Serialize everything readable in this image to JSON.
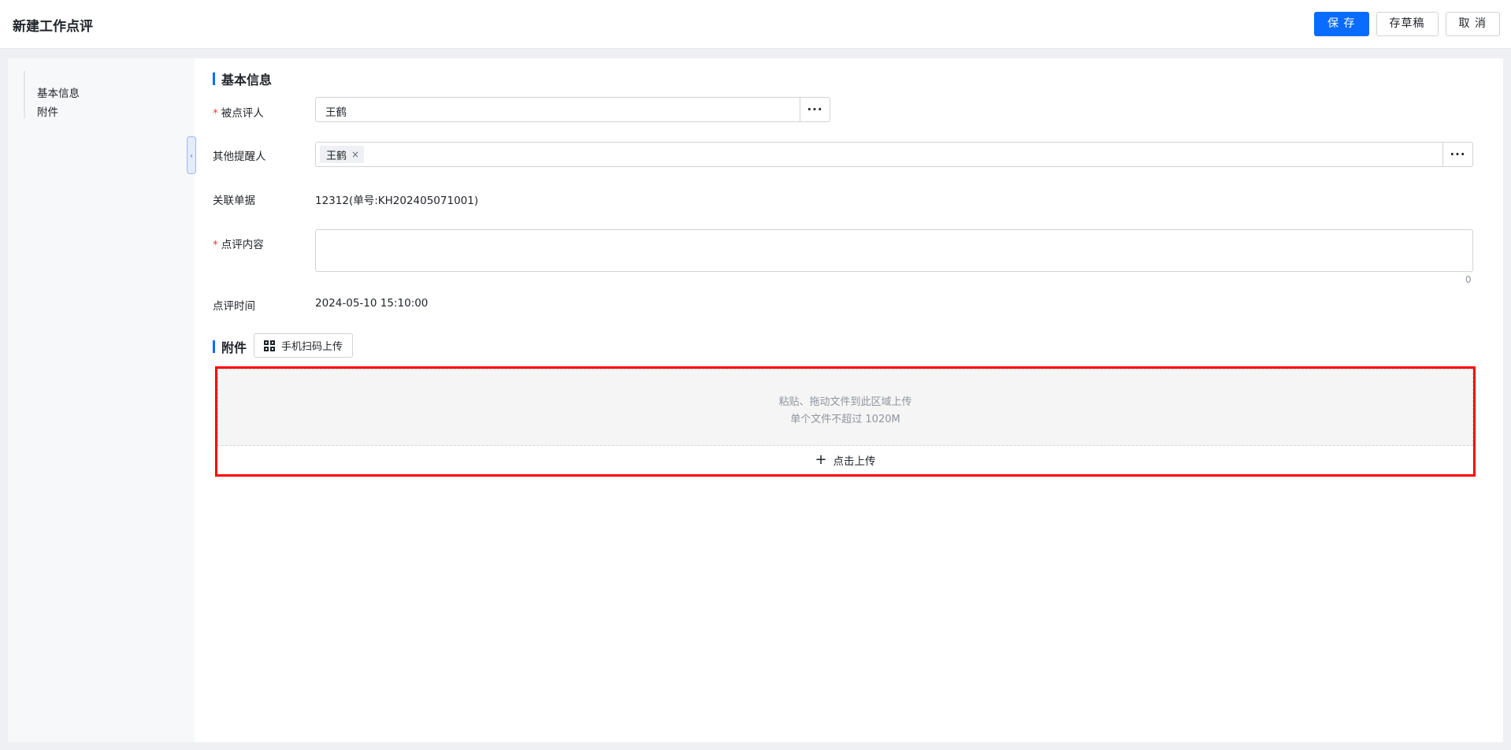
{
  "header": {
    "title": "新建工作点评",
    "save_label": "保 存",
    "draft_label": "存草稿",
    "cancel_label": "取 消"
  },
  "sidebar": {
    "items": [
      {
        "label": "基本信息"
      },
      {
        "label": "附件"
      }
    ],
    "collapse_icon": "chevron-left-icon"
  },
  "basic_info": {
    "section_title": "基本信息",
    "reviewee": {
      "label": "被点评人",
      "value": "王鹤",
      "required": true
    },
    "reminders": {
      "label": "其他提醒人",
      "tags": [
        "王鹤"
      ]
    },
    "related_doc": {
      "label": "关联单据",
      "value": "12312(单号:KH202405071001)"
    },
    "review_content": {
      "label": "点评内容",
      "value": "",
      "char_count": "0",
      "required": true
    },
    "review_time": {
      "label": "点评时间",
      "value": "2024-05-10 15:10:00"
    }
  },
  "attachments": {
    "section_title": "附件",
    "scan_upload_label": "手机扫码上传",
    "drop_hint": "粘贴、拖动文件到此区域上传",
    "size_hint": "单个文件不超过 1020M",
    "click_upload_label": "点击上传"
  },
  "colors": {
    "primary": "#0a6cff",
    "required_mark": "#f23b3b",
    "highlight_frame": "#ff0000"
  }
}
